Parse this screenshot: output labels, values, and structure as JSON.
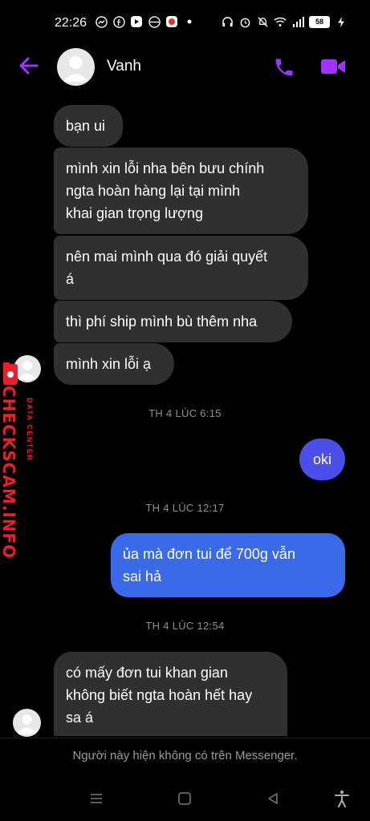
{
  "status_bar": {
    "time": "22:26",
    "battery": "58"
  },
  "header": {
    "contact_name": "Vanh"
  },
  "messages": [
    {
      "text": "bạn ui",
      "direction": "incoming"
    },
    {
      "text": "mình xin lỗi nha bên bưu chính\nngta hoàn hàng lại tại mình\nkhai gian trọng lượng",
      "direction": "incoming"
    },
    {
      "text": "nên mai mình qua đó giải quyết\ná",
      "direction": "incoming"
    },
    {
      "text": "thì phí ship mình bù thêm nha",
      "direction": "incoming"
    },
    {
      "text": "mình xin lỗi ạ",
      "direction": "incoming"
    },
    {
      "text": "oki",
      "direction": "outgoing"
    },
    {
      "text": "ủa mà đơn tui để 700g vẫn\nsai hả",
      "direction": "outgoing"
    },
    {
      "text": "có mấy đơn tui khan gian\nkhông biết ngta hoàn hết hay\nsa á",
      "direction": "incoming"
    }
  ],
  "timestamps": [
    "TH 4 LÚC 6:15",
    "TH 4 LÚC 12:17",
    "TH 4 LÚC 12:54"
  ],
  "footer": {
    "unavailable_note": "Người này hiện không có trên Messenger."
  },
  "watermark": {
    "brand": "CHECKSCAM.INFO",
    "tagline": "DATA CENTER"
  },
  "colors": {
    "accent": "#a033ff",
    "incoming_bubble": "#303030",
    "outgoing_bubble": "#3a6ae8",
    "watermark_red": "#e8202a"
  }
}
